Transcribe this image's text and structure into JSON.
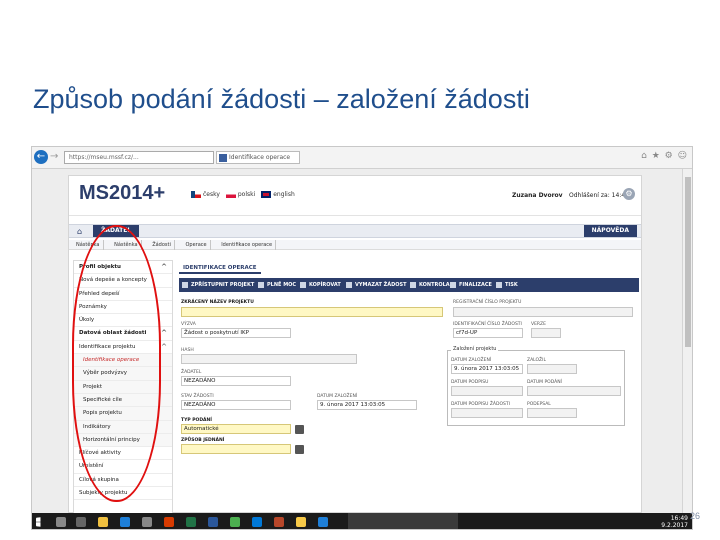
{
  "slide": {
    "title": "Způsob podání žádosti – založení žádosti",
    "page_number": "26"
  },
  "browser": {
    "url": "https://mseu.mssf.cz/...",
    "tab_title": "Identifikace operace",
    "window_controls": [
      "–",
      "□",
      "×"
    ]
  },
  "app": {
    "logo": "MS2014",
    "logo_plus": "+",
    "languages": [
      "česky",
      "polski",
      "english"
    ],
    "user": "Zuzana Dvorov",
    "session": "Odhlášení za: 14:49",
    "nav_main": "ŽADATEL",
    "nav_help": "NÁPOVĚDA",
    "breadcrumb": [
      "Nástěnka",
      "Nástěnka",
      "Žádosti",
      "Operace",
      "Identifikace operace"
    ]
  },
  "sidebar": {
    "items": [
      {
        "label": "Profil objektu",
        "type": "head",
        "chev": "^"
      },
      {
        "label": "Nová depeše a koncepty",
        "type": "item"
      },
      {
        "label": "Přehled depeší",
        "type": "item"
      },
      {
        "label": "Poznámky",
        "type": "item"
      },
      {
        "label": "Úkoly",
        "type": "item"
      },
      {
        "label": "Datová oblast žádosti",
        "type": "head",
        "chev": "^"
      },
      {
        "label": "Identifikace projektu",
        "type": "item",
        "chev": "^"
      },
      {
        "label": "Identifikace operace",
        "type": "active"
      },
      {
        "label": "Výběr podvýzvy",
        "type": "sub"
      },
      {
        "label": "Projekt",
        "type": "sub"
      },
      {
        "label": "Specifické cíle",
        "type": "sub"
      },
      {
        "label": "Popis projektu",
        "type": "sub"
      },
      {
        "label": "Indikátory",
        "type": "sub"
      },
      {
        "label": "Horizontální principy",
        "type": "sub"
      },
      {
        "label": "Klíčové aktivity",
        "type": "item"
      },
      {
        "label": "Umístění",
        "type": "item"
      },
      {
        "label": "Cílová skupina",
        "type": "item"
      },
      {
        "label": "Subjekty projektu",
        "type": "item"
      }
    ]
  },
  "content": {
    "tab": "IDENTIFIKACE OPERACE",
    "toolbar": [
      "ZPŘÍSTUPNIT PROJEKT",
      "PLNĚ MOC",
      "KOPÍROVAT",
      "VYMAZAT ŽÁDOST",
      "KONTROLA",
      "FINALIZACE",
      "TISK"
    ],
    "fields": {
      "nazev_label": "ZKRÁCENÝ NÁZEV PROJEKTU",
      "registracni_label": "REGISTRAČNÍ ČÍSLO PROJEKTU",
      "vyzva_label": "VÝZVA",
      "vyzva_value": "Žádost o poskytnutí IKP",
      "cislo_zadosti_label": "IDENTIFIKAČNÍ ČÍSLO ŽÁDOSTI",
      "cislo_zadosti_value": "cf7d-UP",
      "verze_label": "VERZE",
      "hash_label": "HASH",
      "zadatel_label": "ŽADATEL",
      "zadatel_value": "NEZADÁNO",
      "stav_label": "STAV ŽÁDOSTI",
      "stav_value": "NEZADÁNO",
      "datum_label": "DATUM ZALOŽENÍ",
      "datum_value": "9. února 2017 13:03:05",
      "typ_label": "TYP PODÁNÍ",
      "typ_value": "Automatické",
      "zpusob_label": "ZPŮSOB JEDNÁNÍ",
      "legend": "Založení projektu",
      "legend_fields": [
        {
          "label": "DATUM ZALOŽENÍ",
          "value": "9. února 2017 13:03:05"
        },
        {
          "label": "ZALOŽIL",
          "value": ""
        },
        {
          "label": "DATUM PODPISU",
          "value": ""
        },
        {
          "label": "DATUM PODÁNÍ",
          "value": ""
        },
        {
          "label": "DATUM PODPISU ŽÁDOSTI",
          "value": ""
        },
        {
          "label": "PODEPSAL",
          "value": ""
        }
      ]
    }
  },
  "taskbar": {
    "time": "16:49",
    "date": "9.2.2017"
  },
  "colors": {
    "title": "#1f4e8c",
    "app_primary": "#2c3e6b",
    "highlight_ring": "#e01010",
    "required_field": "#fff8c4"
  }
}
